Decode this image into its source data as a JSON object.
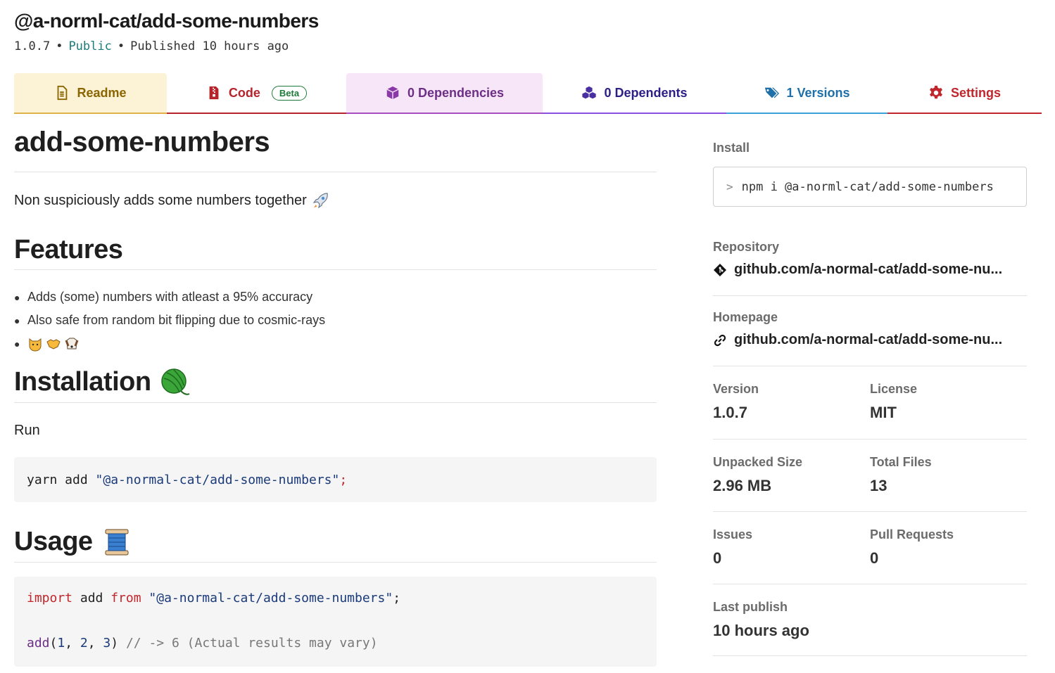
{
  "header": {
    "package_name": "@a-norml-cat/add-some-numbers",
    "version": "1.0.7",
    "visibility": "Public",
    "published": "Published 10 hours ago"
  },
  "tabs": [
    {
      "label": "Readme",
      "icon": "readme-file-icon",
      "color": "#8a6500",
      "active": true
    },
    {
      "label": "Code",
      "icon": "code-zip-icon",
      "badge": "Beta",
      "color": "#b5232b"
    },
    {
      "label": "0 Dependencies",
      "icon": "box-icon",
      "color": "#6d2f86"
    },
    {
      "label": "0 Dependents",
      "icon": "cubes-icon",
      "color": "#2a1f86"
    },
    {
      "label": "1 Versions",
      "icon": "tags-icon",
      "color": "#1f6fa8"
    },
    {
      "label": "Settings",
      "icon": "gear-icon",
      "color": "#c0262c"
    }
  ],
  "readme": {
    "title": "add-some-numbers",
    "description": "Non suspiciously adds some numbers together",
    "description_emoji": "rocket",
    "features_heading": "Features",
    "features": [
      "Adds (some) numbers with atleast a 95% accuracy",
      "Also safe from random bit flipping due to cosmic-rays"
    ],
    "features_emoji_item": [
      "cat-face",
      "handshake",
      "dog-face"
    ],
    "installation_heading": "Installation",
    "installation_emoji": "yarn-ball",
    "run_text": "Run",
    "install_code": {
      "cmd": "yarn add ",
      "pkg": "\"@a-normal-cat/add-some-numbers\"",
      "end": ";"
    },
    "usage_heading": "Usage",
    "usage_emoji": "spool-of-thread",
    "usage_code": {
      "kw1": "import",
      "ident": " add ",
      "kw2": "from",
      "pkg": " \"@a-normal-cat/add-some-numbers\"",
      "semi": ";",
      "fn": "add",
      "open": "(",
      "n1": "1",
      "c1": ", ",
      "n2": "2",
      "c2": ", ",
      "n3": "3",
      "close": ")",
      "comment": " // -> 6 (Actual results may vary)"
    }
  },
  "sidebar": {
    "install_label": "Install",
    "install_cmd": "npm i @a-norml-cat/add-some-numbers",
    "repository_label": "Repository",
    "repository_link": "github.com/a-normal-cat/add-some-nu...",
    "homepage_label": "Homepage",
    "homepage_link": "github.com/a-normal-cat/add-some-nu...",
    "version_label": "Version",
    "version_value": "1.0.7",
    "license_label": "License",
    "license_value": "MIT",
    "unpacked_size_label": "Unpacked Size",
    "unpacked_size_value": "2.96 MB",
    "total_files_label": "Total Files",
    "total_files_value": "13",
    "issues_label": "Issues",
    "issues_value": "0",
    "pull_requests_label": "Pull Requests",
    "pull_requests_value": "0",
    "last_publish_label": "Last publish",
    "last_publish_value": "10 hours ago"
  }
}
